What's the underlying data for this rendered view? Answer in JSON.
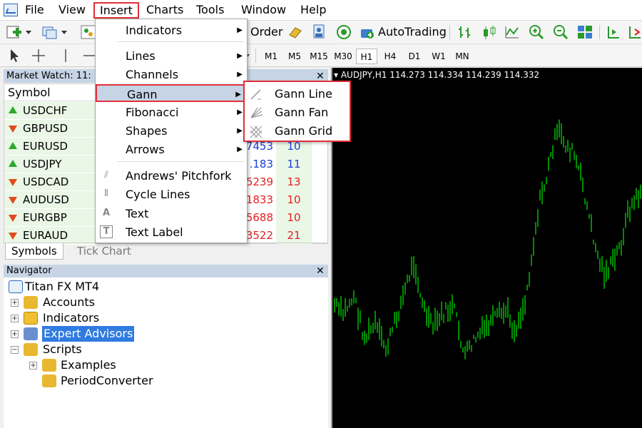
{
  "menubar": {
    "items": [
      "File",
      "View",
      "Insert",
      "Charts",
      "Tools",
      "Window",
      "Help"
    ]
  },
  "toolbar": {
    "order_label": "Order",
    "autotrading_label": "AutoTrading",
    "timeframes": [
      "M1",
      "M5",
      "M15",
      "M30",
      "H1",
      "H4",
      "D1",
      "W1",
      "MN"
    ],
    "active_timeframe": "H1"
  },
  "market_watch": {
    "title": "Market Watch: 11:",
    "column_symbol": "Symbol",
    "rows": [
      {
        "symbol": "USDCHF",
        "dir": "up",
        "bid": "",
        "spread": ""
      },
      {
        "symbol": "GBPUSD",
        "dir": "down",
        "bid": "",
        "spread": ""
      },
      {
        "symbol": "EURUSD",
        "dir": "up",
        "bid": "7453",
        "spread": "10"
      },
      {
        "symbol": "USDJPY",
        "dir": "up",
        "bid": ".183",
        "spread": "11"
      },
      {
        "symbol": "USDCAD",
        "dir": "down",
        "bid": "5239",
        "spread": "13"
      },
      {
        "symbol": "AUDUSD",
        "dir": "down",
        "bid": "1833",
        "spread": "10"
      },
      {
        "symbol": "EURGBP",
        "dir": "down",
        "bid": "5688",
        "spread": "10"
      },
      {
        "symbol": "EURAUD",
        "dir": "down",
        "bid": "3522",
        "spread": "21"
      }
    ],
    "tabs": [
      "Symbols",
      "Tick Chart"
    ]
  },
  "navigator": {
    "title": "Navigator",
    "items": [
      {
        "label": "Titan FX MT4"
      },
      {
        "label": "Accounts"
      },
      {
        "label": "Indicators"
      },
      {
        "label": "Expert Advisors"
      },
      {
        "label": "Scripts"
      },
      {
        "label": "Examples"
      },
      {
        "label": "PeriodConverter"
      }
    ]
  },
  "chart": {
    "header": "AUDJPY,H1  114.273 114.334 114.239 114.332",
    "candle_color": "#00c800"
  },
  "insert_menu": {
    "items": [
      "Indicators",
      "Lines",
      "Channels",
      "Gann",
      "Fibonacci",
      "Shapes",
      "Arrows",
      "Andrews' Pitchfork",
      "Cycle Lines",
      "Text",
      "Text Label"
    ]
  },
  "gann_menu": {
    "items": [
      "Gann Line",
      "Gann Fan",
      "Gann Grid"
    ]
  },
  "colors": {
    "highlight_red": "#e0303a",
    "selection_blue": "#2f7be0",
    "panel_title": "#c6d4e6"
  }
}
